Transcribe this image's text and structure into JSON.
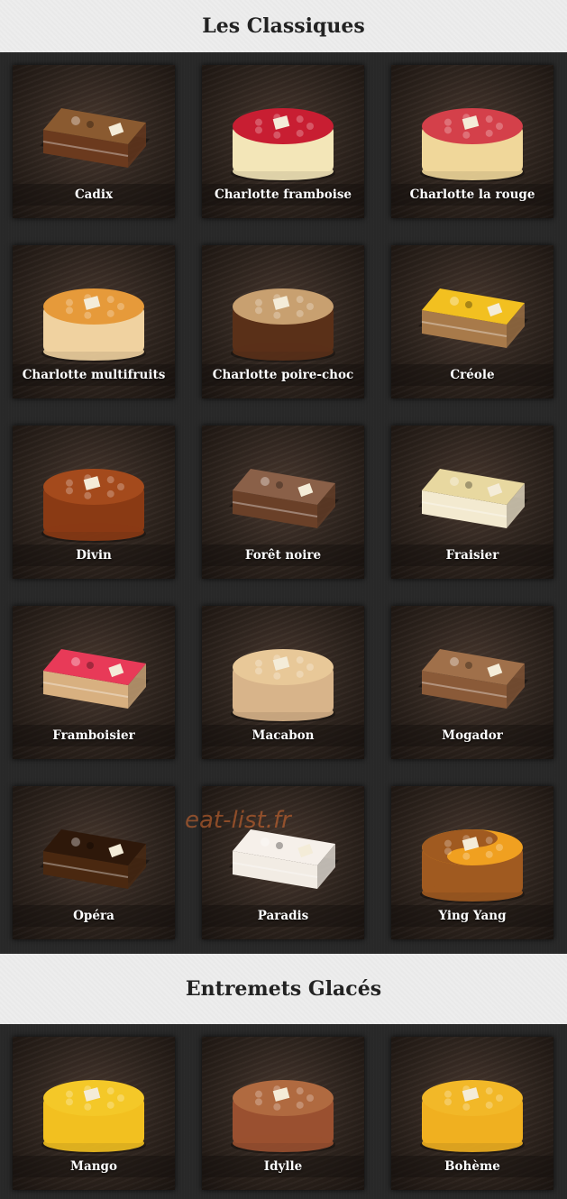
{
  "sections": [
    {
      "title": "Les Classiques",
      "items": [
        {
          "label": "Cadix",
          "icon": "cake-rect-chocolate",
          "color": "#6b3a1e",
          "top": "#8a5a30"
        },
        {
          "label": "Charlotte framboise",
          "icon": "cake-round-raspberry",
          "color": "#f3e6b8",
          "top": "#c81e32"
        },
        {
          "label": "Charlotte la rouge",
          "icon": "cake-round-raspberry",
          "color": "#f0d79a",
          "top": "#d4404a"
        },
        {
          "label": "Charlotte multifruits",
          "icon": "cake-round-fruits",
          "color": "#f0d2a0",
          "top": "#e69a3a"
        },
        {
          "label": "Charlotte poire-choc",
          "icon": "cake-round-chocolate",
          "color": "#5a3018",
          "top": "#c8a070"
        },
        {
          "label": "Créole",
          "icon": "cake-rect-yellow",
          "color": "#a87a4a",
          "top": "#f2c020"
        },
        {
          "label": "Divin",
          "icon": "cake-round-glazed",
          "color": "#8a3a14",
          "top": "#a44a1c"
        },
        {
          "label": "Forêt noire",
          "icon": "cake-rect-chocolate",
          "color": "#6a4028",
          "top": "#8a6048"
        },
        {
          "label": "Fraisier",
          "icon": "cake-rect-strawberry",
          "color": "#f3ead0",
          "top": "#e8d8a0"
        },
        {
          "label": "Framboisier",
          "icon": "cake-rect-pink",
          "color": "#d8b080",
          "top": "#e83a58"
        },
        {
          "label": "Macabon",
          "icon": "cake-round-macaron",
          "color": "#d8b48a",
          "top": "#e8c898"
        },
        {
          "label": "Mogador",
          "icon": "cake-rect-chocolate",
          "color": "#8a5a38",
          "top": "#a0704a"
        },
        {
          "label": "Opéra",
          "icon": "cake-rect-opera",
          "color": "#4a2810",
          "top": "#2e180a"
        },
        {
          "label": "Paradis",
          "icon": "cake-rect-white",
          "color": "#f2ece4",
          "top": "#f6f0ea"
        },
        {
          "label": "Ying Yang",
          "icon": "cake-round-yinyang",
          "color": "#a05a20",
          "top": "#f0a020"
        }
      ]
    },
    {
      "title": "Entremets Glacés",
      "items": [
        {
          "label": "Mango",
          "icon": "cake-round-mango",
          "color": "#f2c020",
          "top": "#f4c828"
        },
        {
          "label": "Idylle",
          "icon": "cake-round-chocolate-glace",
          "color": "#9a5030",
          "top": "#b06a40"
        },
        {
          "label": "Bohème",
          "icon": "cake-round-boheme",
          "color": "#f0b020",
          "top": "#f2b828"
        }
      ]
    }
  ],
  "watermark": "eat-list.fr"
}
